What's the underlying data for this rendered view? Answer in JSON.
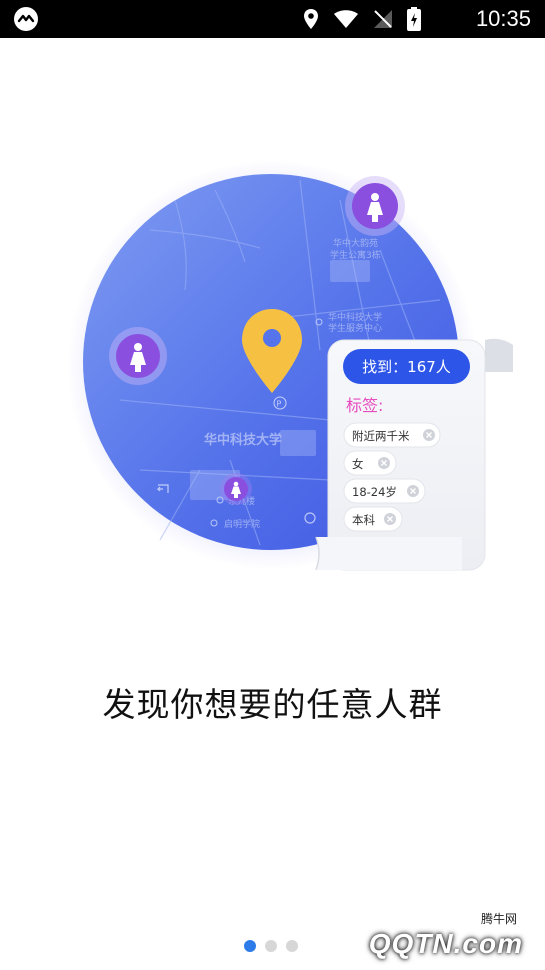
{
  "status_bar": {
    "time": "10:35"
  },
  "hero": {
    "map_labels": {
      "university": "华中科技大学",
      "apartment_line1": "华中大韵苑",
      "apartment_line2": "学生公寓3栋",
      "service_line1": "华中科技大学",
      "service_line2": "学生服务中心",
      "building": "东九楼",
      "college": "启明学院",
      "parking": "P"
    },
    "result_card": {
      "found": "找到：167人",
      "tags_title": "标签:",
      "tags": [
        "附近两千米",
        "女",
        "18-24岁",
        "本科"
      ]
    }
  },
  "headline": "发现你想要的任意人群",
  "pager": {
    "count": 3,
    "active": 0
  },
  "watermark": {
    "brand": "腾牛网",
    "logo": "QQTN.com"
  },
  "colors": {
    "accent_blue": "#2d55e8",
    "pin_yellow": "#f6c143",
    "tag_pink": "#e74bbf",
    "avatar_purple": "#8b4fe0"
  }
}
